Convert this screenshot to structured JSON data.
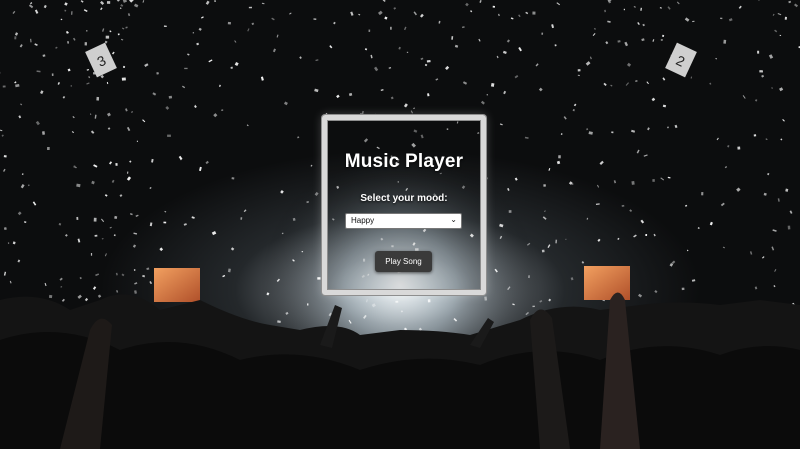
{
  "player": {
    "title": "Music Player",
    "mood_label": "Select your mood:",
    "mood_selected": "Happy",
    "play_button_label": "Play Song"
  },
  "background": {
    "signs": [
      "3",
      "2"
    ]
  },
  "colors": {
    "panel_border": "#d9d9d9",
    "button_bg": "#3a3a3a",
    "screen_glow": "#e0803a"
  },
  "icons": {
    "select_arrow": "chevron-down-icon"
  }
}
